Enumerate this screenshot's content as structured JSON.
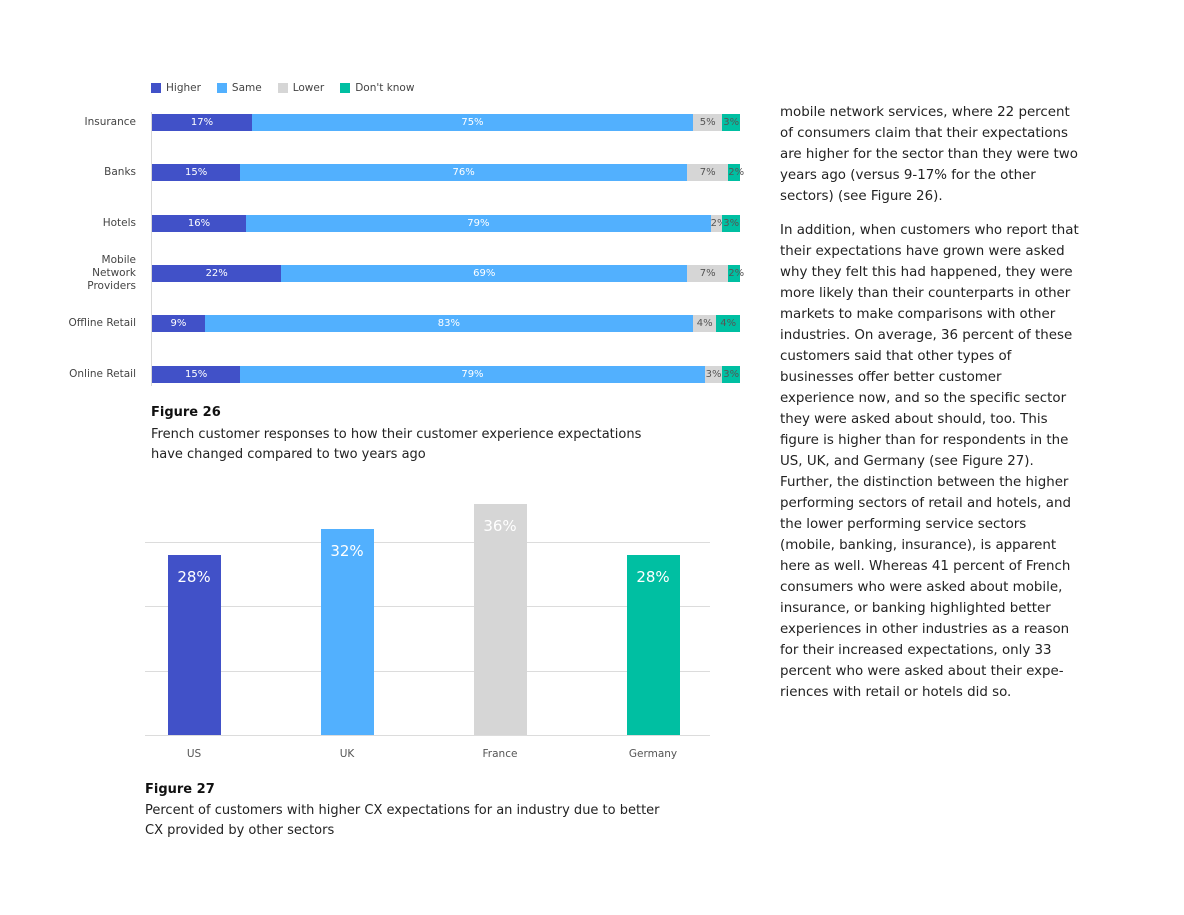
{
  "colors": {
    "higher": "#4151C8",
    "same": "#52B0FE",
    "lower": "#D6D6D6",
    "dont_know": "#00BFA2"
  },
  "chart_data": [
    {
      "type": "bar",
      "orientation": "horizontal",
      "stacked": true,
      "title": "Figure 26",
      "caption": "French customer responses to how their customer experience expectations have changed compared to two years ago",
      "legend": [
        "Higher",
        "Same",
        "Lower",
        "Don't know"
      ],
      "legend_placement": "top-left",
      "xlim": [
        0,
        100
      ],
      "categories": [
        "Insurance",
        "Banks",
        "Hotels",
        "Mobile Network Providers",
        "Offline Retail",
        "Online Retail"
      ],
      "category_lines": [
        [
          "Insurance"
        ],
        [
          "Banks"
        ],
        [
          "Hotels"
        ],
        [
          "Mobile",
          "Network",
          "Providers"
        ],
        [
          "Offline Retail"
        ],
        [
          "Online Retail"
        ]
      ],
      "series": [
        {
          "name": "Higher",
          "key": "higher",
          "values": [
            17,
            15,
            16,
            22,
            9,
            15
          ]
        },
        {
          "name": "Same",
          "key": "same",
          "values": [
            75,
            76,
            79,
            69,
            83,
            79
          ]
        },
        {
          "name": "Lower",
          "key": "lower",
          "values": [
            5,
            7,
            2,
            7,
            4,
            3
          ]
        },
        {
          "name": "Don't know",
          "key": "dont_know",
          "values": [
            3,
            2,
            3,
            2,
            4,
            3
          ]
        }
      ],
      "grid": false
    },
    {
      "type": "bar",
      "orientation": "vertical",
      "title": "Figure 27",
      "caption": "Percent of customers with higher CX expectations for an industry due to better CX provided by other sectors",
      "categories": [
        "US",
        "UK",
        "France",
        "Germany"
      ],
      "values": [
        28,
        32,
        36,
        28
      ],
      "value_labels": [
        "28%",
        "32%",
        "36%",
        "28%"
      ],
      "bar_color_keys": [
        "higher",
        "same",
        "lower",
        "dont_know"
      ],
      "ylim": [
        0,
        36
      ],
      "gridlines": [
        0,
        10,
        20,
        30
      ],
      "grid": true,
      "xlabel": "",
      "ylabel": ""
    }
  ],
  "body_text": {
    "paragraphs": [
      "mobile network services, where 22 percent of consumers claim that their expectations are higher for the sector than they were two years ago (versus 9-17% for the other sectors) (see Figure 26).",
      "In addition, when customers who report that their expectations have grown were asked why they felt this had happened, they were more likely than their counterparts in other markets to make comparisons with other industries. On average, 36 percent of these customers said that other types of businesses offer better customer experience now, and so the specific sector they were asked about should, too. This figure is higher than for respondents in the US, UK, and Germany (see Figure 27). Further, the distinction between the higher performing sectors of retail and hotels, and the lower performing service sectors (mobile, banking, insurance), is apparent here as well. Whereas 41 percent of French consumers who were asked about mobile, insurance, or banking highlighted better experiences in other industries as a reason for their increased expectations, only 33 percent who were asked about their expe-riences with retail or hotels did so."
    ]
  }
}
